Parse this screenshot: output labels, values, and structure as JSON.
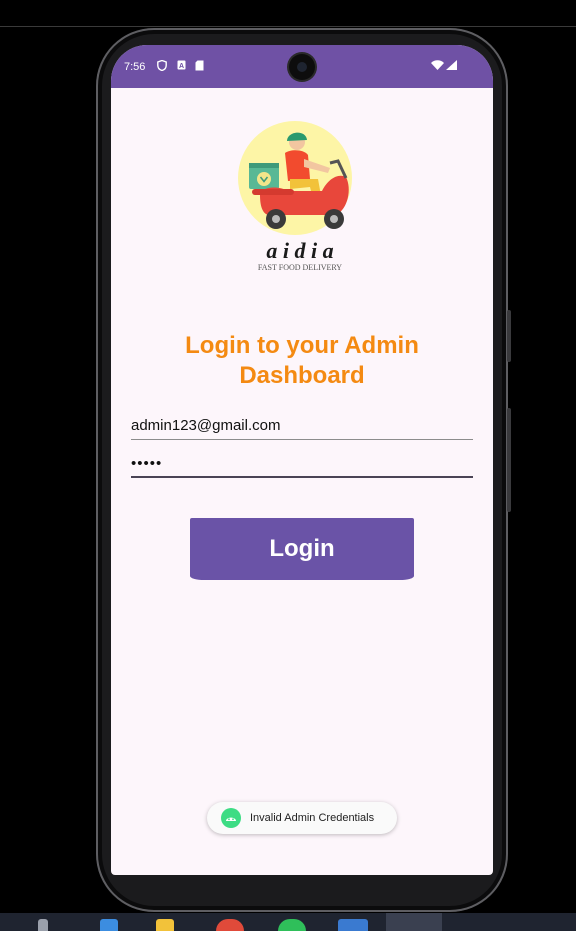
{
  "status_bar": {
    "time": "7:56",
    "icons": [
      "shield-icon",
      "a-icon",
      "sd-card-icon",
      "wifi-icon",
      "signal-icon"
    ]
  },
  "logo": {
    "wordmark": "a i d i a",
    "tagline": "FAST FOOD DELIVERY"
  },
  "login": {
    "title_line1": "Login to your Admin",
    "title_line2": "Dashboard",
    "email_value": "admin123@gmail.com",
    "password_value": "•••••",
    "button_label": "Login"
  },
  "toast": {
    "message": "Invalid Admin Credentials"
  },
  "colors": {
    "status_bar": "#6f51a5",
    "title": "#f48a12",
    "button": "#6a53a7",
    "screen_bg": "#fdf6fb"
  }
}
